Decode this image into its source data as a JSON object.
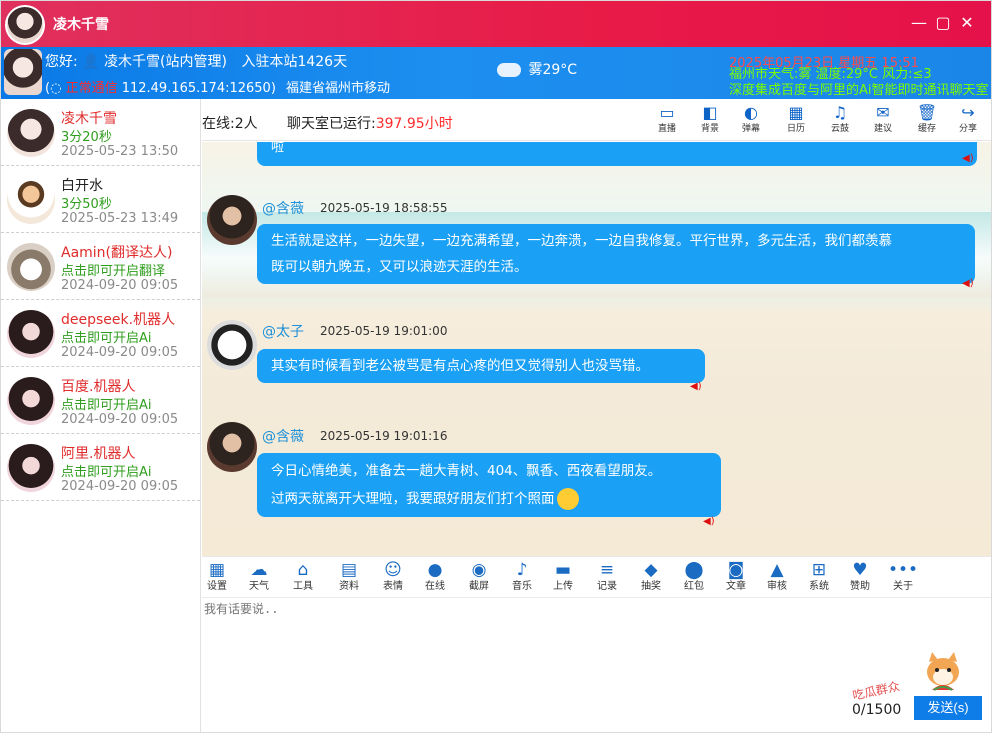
{
  "titlebar": {
    "title": "凌木千雪",
    "minimize": "—",
    "maximize": "▢",
    "close": "✕"
  },
  "infobar": {
    "greeting": "您好:",
    "username": "凌木千雪(站内管理)",
    "joined": "入驻本站1426天",
    "status_label": "正常通信",
    "ip": "112.49.165.174:12650)",
    "location": "福建省福州市移动",
    "weather": "雾29°C",
    "marquee_red": "2025年05月23日 星期五 15:51",
    "weather_detail": "福州市天气:雾 温度:29°C 风力:≤3",
    "announcement": "深度集成百度与阿里的Ai智能即时通讯聊天室"
  },
  "sidebar": {
    "users": [
      {
        "name": "凌木千雪",
        "status": "3分20秒",
        "time": "2025-05-23 13:50",
        "name_color": "#e02b2b"
      },
      {
        "name": "白开水",
        "status": "3分50秒",
        "time": "2025-05-23 13:49",
        "name_color": "#222222"
      },
      {
        "name": "Aamin(翻译达人)",
        "status": "点击即可开启翻译",
        "time": "2024-09-20 09:05",
        "name_color": "#e02b2b"
      },
      {
        "name": "deepseek.机器人",
        "status": "点击即可开启Ai",
        "time": "2024-09-20 09:05",
        "name_color": "#e02b2b"
      },
      {
        "name": "百度.机器人",
        "status": "点击即可开启Ai",
        "time": "2024-09-20 09:05",
        "name_color": "#e02b2b"
      },
      {
        "name": "阿里.机器人",
        "status": "点击即可开启Ai",
        "time": "2024-09-20 09:05",
        "name_color": "#e02b2b"
      }
    ]
  },
  "chatbar": {
    "online_label": "在线:",
    "online_count": "2人",
    "uptime_label": "聊天室已运行:",
    "uptime_value": "397.95小时",
    "icons": [
      {
        "icon": "monitor-icon",
        "glyph": "▭",
        "label": "直播"
      },
      {
        "icon": "background-icon",
        "glyph": "◧",
        "label": "背景"
      },
      {
        "icon": "toggle-icon",
        "glyph": "◐",
        "label": "弹幕"
      },
      {
        "icon": "calendar-icon",
        "glyph": "▦",
        "label": "日历"
      },
      {
        "icon": "bell-icon",
        "glyph": "♫",
        "label": "云鼓"
      },
      {
        "icon": "mail-icon",
        "glyph": "✉",
        "label": "建议"
      },
      {
        "icon": "trash-icon",
        "glyph": "🗑",
        "label": "缓存"
      },
      {
        "icon": "share-icon",
        "glyph": "↪",
        "label": "分享"
      }
    ]
  },
  "chat": {
    "partial_text": "啦",
    "messages": [
      {
        "name": "@含薇",
        "time": "2025-05-19 18:58:55",
        "lines": [
          "生活就是这样，一边失望，一边充满希望，一边奔溃，一边自我修复。平行世界，多元生活，我们都羡慕",
          "既可以朝九晚五，又可以浪迹天涯的生活。"
        ]
      },
      {
        "name": "@太子",
        "time": "2025-05-19 19:01:00",
        "lines": [
          "其实有时候看到老公被骂是有点心疼的但又觉得别人也没骂错。"
        ]
      },
      {
        "name": "@含薇",
        "time": "2025-05-19 19:01:16",
        "lines": [
          "今日心情绝美，准备去一趟大青树、404、飘香、西夜看望朋友。",
          "过两天就离开大理啦，我要跟好朋友们打个照面"
        ]
      }
    ]
  },
  "toolbar": {
    "tools": [
      {
        "icon": "settings-icon",
        "glyph": "▦",
        "label": "设置"
      },
      {
        "icon": "cloud-icon",
        "glyph": "☁",
        "label": "天气"
      },
      {
        "icon": "bank-icon",
        "glyph": "⌂",
        "label": "工具"
      },
      {
        "icon": "id-card-icon",
        "glyph": "▤",
        "label": "资料"
      },
      {
        "icon": "smile-icon",
        "glyph": "☺",
        "label": "表情"
      },
      {
        "icon": "user-icon",
        "glyph": "●",
        "label": "在线"
      },
      {
        "icon": "camera-icon",
        "glyph": "◉",
        "label": "截屏"
      },
      {
        "icon": "music-icon",
        "glyph": "♪",
        "label": "音乐"
      },
      {
        "icon": "folder-icon",
        "glyph": "▬",
        "label": "上传"
      },
      {
        "icon": "server-icon",
        "glyph": "≡",
        "label": "记录"
      },
      {
        "icon": "diamond-icon",
        "glyph": "◆",
        "label": "抽奖"
      },
      {
        "icon": "database-icon",
        "glyph": "⬤",
        "label": "红包"
      },
      {
        "icon": "rss-icon",
        "glyph": "◙",
        "label": "文章"
      },
      {
        "icon": "broadcast-icon",
        "glyph": "▲",
        "label": "审核"
      },
      {
        "icon": "windows-icon",
        "glyph": "⊞",
        "label": "系统"
      },
      {
        "icon": "heart-icon",
        "glyph": "♥",
        "label": "赞助"
      },
      {
        "icon": "more-icon",
        "glyph": "•••",
        "label": "关于"
      }
    ]
  },
  "input": {
    "placeholder": "我有话要说..",
    "counter": "0/1500",
    "send_label": "发送(s)",
    "mascot_label": "吃瓜群众"
  }
}
